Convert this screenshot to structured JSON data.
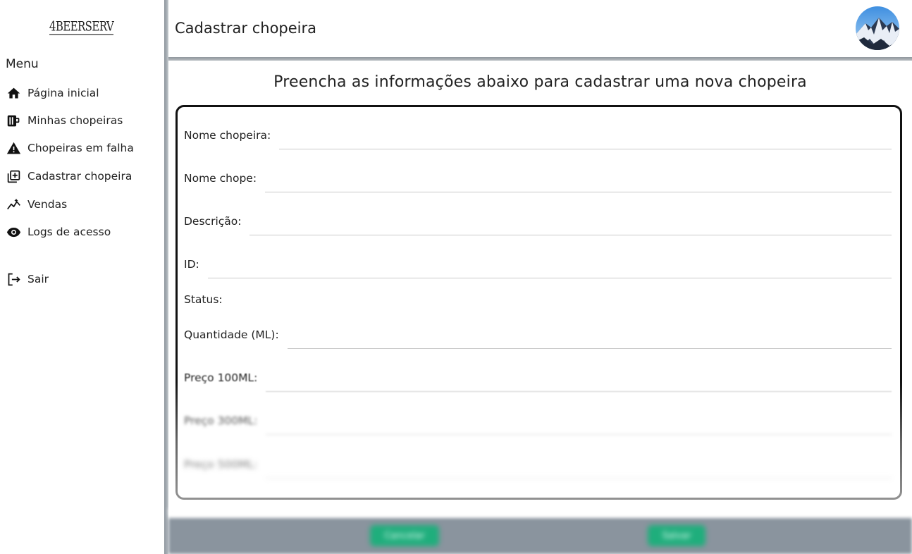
{
  "brand": {
    "logo_text": "4BEERSERV"
  },
  "sidebar": {
    "menu_title": "Menu",
    "items": [
      {
        "label": "Página inicial",
        "icon": "home-icon"
      },
      {
        "label": "Minhas chopeiras",
        "icon": "beer-mug-icon"
      },
      {
        "label": "Chopeiras em falha",
        "icon": "warning-icon"
      },
      {
        "label": "Cadastrar chopeira",
        "icon": "add-box-icon"
      },
      {
        "label": "Vendas",
        "icon": "sparkline-icon"
      },
      {
        "label": "Logs de acesso",
        "icon": "eye-icon"
      }
    ],
    "logout": {
      "label": "Sair",
      "icon": "logout-icon"
    }
  },
  "header": {
    "title": "Cadastrar chopeira",
    "avatar": "mountain-avatar"
  },
  "main": {
    "subtitle": "Preencha as informações abaixo para cadastrar uma nova chopeira",
    "fields": [
      {
        "label": "Nome chopeira:",
        "value": ""
      },
      {
        "label": "Nome chope:",
        "value": ""
      },
      {
        "label": "Descrição:",
        "value": ""
      },
      {
        "label": "ID:",
        "value": ""
      },
      {
        "label": "Status:"
      },
      {
        "label": "Quantidade (ML):",
        "value": ""
      },
      {
        "label": "Preço 100ML:",
        "value": ""
      },
      {
        "label": "Preço 300ML:",
        "value": ""
      },
      {
        "label": "Preço 500ML:",
        "value": ""
      }
    ]
  },
  "footer": {
    "primary_button": "Cancelar",
    "secondary_button": "Salvar"
  },
  "colors": {
    "accent": "#1fae7c",
    "divider": "#8f969c",
    "footer": "#8a949e"
  }
}
